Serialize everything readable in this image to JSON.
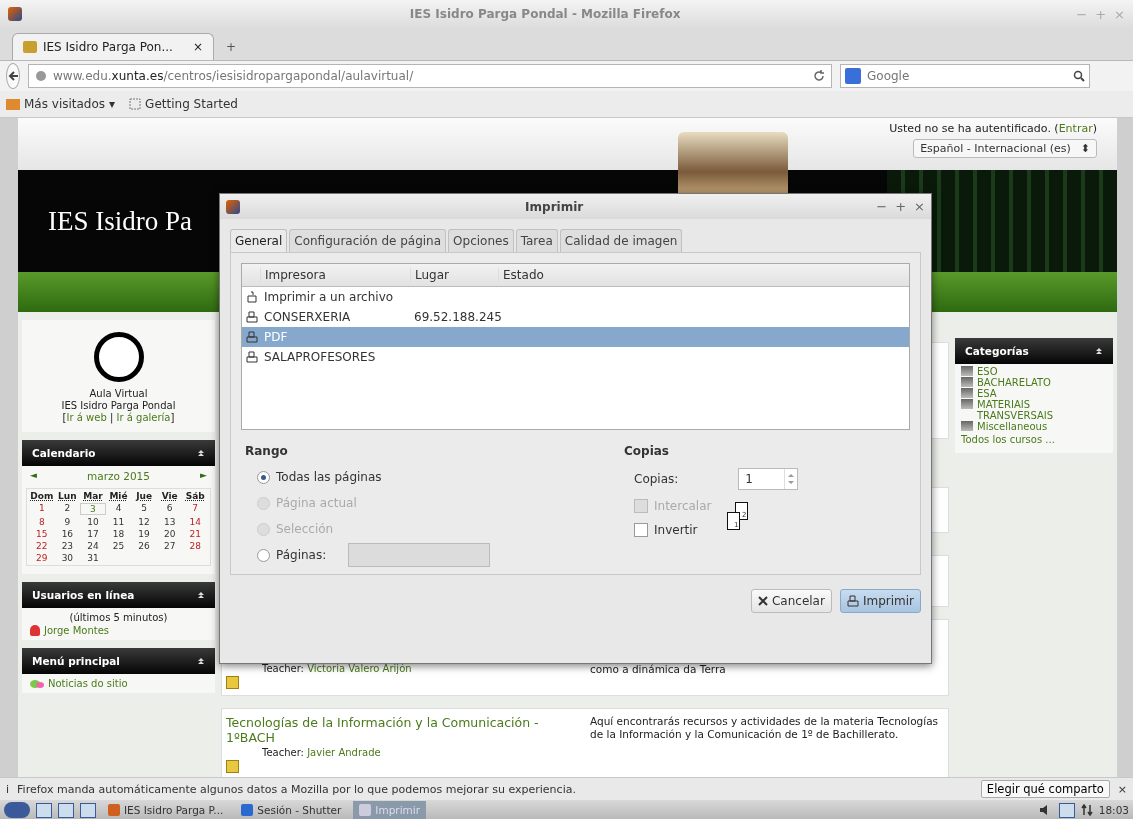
{
  "browser": {
    "title": "IES Isidro Parga Pondal - Mozilla Firefox",
    "window_controls": [
      "−",
      "+",
      "×"
    ],
    "tabs": [
      {
        "label": "IES Isidro Parga Pon...",
        "close": "×",
        "selected": true
      }
    ],
    "new_tab": "+",
    "url": "www.edu.**xunta.es**/centros/iesisidropargapondal/aulavirtual/",
    "search_placeholder": "Google",
    "bookmarks": [
      {
        "label": "Más visitados",
        "kind": "folder",
        "caret": "▾"
      },
      {
        "label": "Getting Started",
        "kind": "page"
      }
    ]
  },
  "page": {
    "login": {
      "before": "Usted no se ha autentificado. (",
      "link": "Entrar",
      "after": ")"
    },
    "language": "Español - Internacional (es)",
    "language_caret": "⬍",
    "site_title": "IES Isidro Pa",
    "logo_block": {
      "title": "Aula Virtual",
      "subtitle": "IES Isidro Parga Pondal",
      "open": "[",
      "links": [
        "Ir á web",
        "Ir á galería"
      ],
      "separator": "|",
      "close": "]"
    },
    "calendar": {
      "title": "Calendario",
      "prev": "◄",
      "month": "marzo 2015",
      "next": "►",
      "weekdays": [
        "Dom",
        "Lun",
        "Mar",
        "Mié",
        "Jue",
        "Vie",
        "Sáb"
      ],
      "weeks": [
        [
          {
            "day": "1",
            "today": false
          },
          {
            "day": "2",
            "today": false
          },
          {
            "day": "3",
            "today": true
          },
          {
            "day": "4",
            "today": false
          },
          {
            "day": "5",
            "today": false
          },
          {
            "day": "6",
            "today": false
          },
          {
            "day": "7",
            "today": false
          }
        ],
        [
          {
            "day": "8",
            "today": false
          },
          {
            "day": "9",
            "today": false
          },
          {
            "day": "10",
            "today": false
          },
          {
            "day": "11",
            "today": false
          },
          {
            "day": "12",
            "today": false
          },
          {
            "day": "13",
            "today": false
          },
          {
            "day": "14",
            "today": false
          }
        ],
        [
          {
            "day": "15",
            "today": false
          },
          {
            "day": "16",
            "today": false
          },
          {
            "day": "17",
            "today": false
          },
          {
            "day": "18",
            "today": false
          },
          {
            "day": "19",
            "today": false
          },
          {
            "day": "20",
            "today": false
          },
          {
            "day": "21",
            "today": false
          }
        ],
        [
          {
            "day": "22",
            "today": false
          },
          {
            "day": "23",
            "today": false
          },
          {
            "day": "24",
            "today": false
          },
          {
            "day": "25",
            "today": false
          },
          {
            "day": "26",
            "today": false
          },
          {
            "day": "27",
            "today": false
          },
          {
            "day": "28",
            "today": false
          }
        ],
        [
          {
            "day": "29",
            "today": false
          },
          {
            "day": "30",
            "today": false
          },
          {
            "day": "31",
            "today": false
          }
        ]
      ]
    },
    "online_users": {
      "title": "Usuarios en línea",
      "period": "(últimos 5 minutos)",
      "users": [
        "Jorge Montes"
      ]
    },
    "main_menu": {
      "title": "Menú principal",
      "items": [
        "Noticias do sitio"
      ]
    },
    "courses": [
      {
        "teacher_label": "Teacher:",
        "teacher": "Victoria Valero Arijón",
        "description": "como a dinámica da Terra"
      },
      {
        "title": "Tecnologías de la Información y la Comunicación - 1ºBACH",
        "teacher_label": "Teacher:",
        "teacher": "Javier Andrade",
        "description": "Aquí encontrarás recursos y actividades de la materia Tecnologías de la Información y la Comunicación de 1º de Bachillerato."
      }
    ],
    "categories": {
      "title": "Categorías",
      "items": [
        "ESO",
        "BACHARELATO",
        "ESA",
        "MATERIAIS TRANSVERSAIS",
        "Miscellaneous"
      ],
      "all_link": "Todos los cursos ..."
    }
  },
  "print_dialog": {
    "title": "Imprimir",
    "window_controls": [
      "−",
      "+",
      "×"
    ],
    "tabs": [
      {
        "label": "General",
        "selected": true
      },
      {
        "label": "Configuración de página",
        "selected": false
      },
      {
        "label": "Opciones",
        "selected": false
      },
      {
        "label": "Tarea",
        "selected": false
      },
      {
        "label": "Calidad de imagen",
        "selected": false
      }
    ],
    "columns": [
      "Impresora",
      "Lugar",
      "Estado"
    ],
    "printers": [
      {
        "name": "Imprimir a un archivo",
        "kind": "file",
        "selected": false
      },
      {
        "name": "CONSERXERIA",
        "location": "69.52.188.245",
        "kind": "printer",
        "selected": false
      },
      {
        "name": "PDF",
        "kind": "printer",
        "selected": true
      },
      {
        "name": "SALAPROFESORES",
        "kind": "printer",
        "selected": false
      }
    ],
    "range": {
      "title": "Rango",
      "options": [
        {
          "label": "Todas las páginas",
          "selected": true,
          "disabled": false
        },
        {
          "label": "Página actual",
          "selected": false,
          "disabled": true
        },
        {
          "label": "Selección",
          "selected": false,
          "disabled": true
        },
        {
          "label": "Páginas:",
          "selected": false,
          "disabled": false,
          "kind": "pages"
        }
      ]
    },
    "copies": {
      "title": "Copias",
      "label": "Copias:",
      "value": "1",
      "options": [
        {
          "label": "Intercalar",
          "checked": false,
          "disabled": true
        },
        {
          "label": "Invertir",
          "checked": false,
          "disabled": false
        }
      ],
      "collate_pages": [
        "1",
        "2"
      ]
    },
    "buttons": [
      {
        "label": "Cancelar",
        "kind": "cancel"
      },
      {
        "label": "Imprimir",
        "kind": "print"
      }
    ]
  },
  "notification": {
    "icon": "i",
    "text": "Firefox manda automáticamente algunos datos a Mozilla por lo que podemos mejorar su experiencia.",
    "button": "Elegir qué comparto",
    "close": "×"
  },
  "taskbar": {
    "tasks": [
      {
        "label": "IES Isidro Parga P...",
        "kind": "browser",
        "selected": false
      },
      {
        "label": "Sesión - Shutter",
        "kind": "shutter",
        "selected": false
      },
      {
        "label": "Imprimir",
        "kind": "window",
        "selected": true
      }
    ],
    "clock": "18:03"
  }
}
